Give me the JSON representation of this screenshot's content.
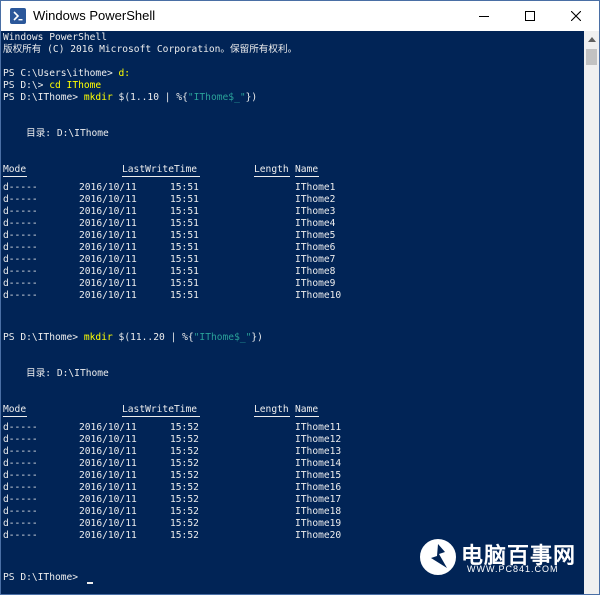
{
  "window": {
    "title": "Windows PowerShell",
    "icon": "powershell-icon",
    "controls": [
      "minimize-icon",
      "maximize-icon",
      "close-icon"
    ],
    "colors": {
      "background": "#012456",
      "text": "#ededed",
      "command": "#ffff00",
      "string": "#2aa198"
    }
  },
  "header": {
    "line1": "Windows PowerShell",
    "line2": "版权所有 (C) 2016 Microsoft Corporation。保留所有权利。"
  },
  "commands": {
    "c1_prompt": "PS C:\\Users\\ithome> ",
    "c1_cmd": "d:",
    "c2_prompt": "PS D:\\> ",
    "c2_cmd": "cd IThome",
    "c3_prompt": "PS D:\\IThome> ",
    "c3_cmd": "mkdir",
    "c3_rest1": " $(1..10 | %{",
    "c3_str": "\"IThome$_\"",
    "c3_rest2": "})",
    "c4_prompt": "PS D:\\IThome> ",
    "c4_cmd": "mkdir",
    "c4_rest1": " $(11..20 | %{",
    "c4_str": "\"IThome$_\"",
    "c4_rest2": "})",
    "c5_prompt": "PS D:\\IThome> "
  },
  "listings": [
    {
      "directory_label": "    目录: D:\\IThome",
      "headers": {
        "mode": "Mode",
        "lastwritetime": "LastWriteTime",
        "length": "Length",
        "name": "Name"
      },
      "rows": [
        {
          "mode": "d-----",
          "date": "2016/10/11",
          "time": "15:51",
          "name": "IThome1"
        },
        {
          "mode": "d-----",
          "date": "2016/10/11",
          "time": "15:51",
          "name": "IThome2"
        },
        {
          "mode": "d-----",
          "date": "2016/10/11",
          "time": "15:51",
          "name": "IThome3"
        },
        {
          "mode": "d-----",
          "date": "2016/10/11",
          "time": "15:51",
          "name": "IThome4"
        },
        {
          "mode": "d-----",
          "date": "2016/10/11",
          "time": "15:51",
          "name": "IThome5"
        },
        {
          "mode": "d-----",
          "date": "2016/10/11",
          "time": "15:51",
          "name": "IThome6"
        },
        {
          "mode": "d-----",
          "date": "2016/10/11",
          "time": "15:51",
          "name": "IThome7"
        },
        {
          "mode": "d-----",
          "date": "2016/10/11",
          "time": "15:51",
          "name": "IThome8"
        },
        {
          "mode": "d-----",
          "date": "2016/10/11",
          "time": "15:51",
          "name": "IThome9"
        },
        {
          "mode": "d-----",
          "date": "2016/10/11",
          "time": "15:51",
          "name": "IThome10"
        }
      ]
    },
    {
      "directory_label": "    目录: D:\\IThome",
      "headers": {
        "mode": "Mode",
        "lastwritetime": "LastWriteTime",
        "length": "Length",
        "name": "Name"
      },
      "rows": [
        {
          "mode": "d-----",
          "date": "2016/10/11",
          "time": "15:52",
          "name": "IThome11"
        },
        {
          "mode": "d-----",
          "date": "2016/10/11",
          "time": "15:52",
          "name": "IThome12"
        },
        {
          "mode": "d-----",
          "date": "2016/10/11",
          "time": "15:52",
          "name": "IThome13"
        },
        {
          "mode": "d-----",
          "date": "2016/10/11",
          "time": "15:52",
          "name": "IThome14"
        },
        {
          "mode": "d-----",
          "date": "2016/10/11",
          "time": "15:52",
          "name": "IThome15"
        },
        {
          "mode": "d-----",
          "date": "2016/10/11",
          "time": "15:52",
          "name": "IThome16"
        },
        {
          "mode": "d-----",
          "date": "2016/10/11",
          "time": "15:52",
          "name": "IThome17"
        },
        {
          "mode": "d-----",
          "date": "2016/10/11",
          "time": "15:52",
          "name": "IThome18"
        },
        {
          "mode": "d-----",
          "date": "2016/10/11",
          "time": "15:52",
          "name": "IThome19"
        },
        {
          "mode": "d-----",
          "date": "2016/10/11",
          "time": "15:52",
          "name": "IThome20"
        }
      ]
    }
  ],
  "watermark": {
    "text": "电脑百事网",
    "url": "WWW.PC841.COM",
    "icon": "pc841-logo-icon"
  }
}
